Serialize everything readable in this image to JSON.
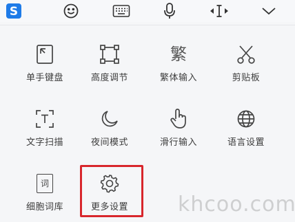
{
  "toolbar": {
    "icons": [
      "sogou-logo-icon",
      "emoji-icon",
      "keyboard-icon",
      "microphone-icon",
      "cursor-move-icon",
      "collapse-chevron-icon"
    ],
    "accent": "#1e7be8"
  },
  "menu": {
    "items": [
      {
        "label": "单手键盘",
        "icon": "one-hand-keyboard-icon"
      },
      {
        "label": "高度调节",
        "icon": "height-adjust-icon"
      },
      {
        "label": "繁体输入",
        "icon": "traditional-chinese-icon",
        "glyph": "繁"
      },
      {
        "label": "剪贴板",
        "icon": "clipboard-scissors-icon"
      },
      {
        "label": "文字扫描",
        "icon": "text-scan-icon"
      },
      {
        "label": "夜间模式",
        "icon": "moon-icon"
      },
      {
        "label": "滑行输入",
        "icon": "swipe-input-icon"
      },
      {
        "label": "语言设置",
        "icon": "globe-icon"
      },
      {
        "label": "细胞词库",
        "icon": "cell-dictionary-icon",
        "glyph": "词"
      },
      {
        "label": "更多设置",
        "icon": "gear-icon"
      }
    ],
    "highlight_color": "#d8262c"
  },
  "watermark": "khcoo.com"
}
